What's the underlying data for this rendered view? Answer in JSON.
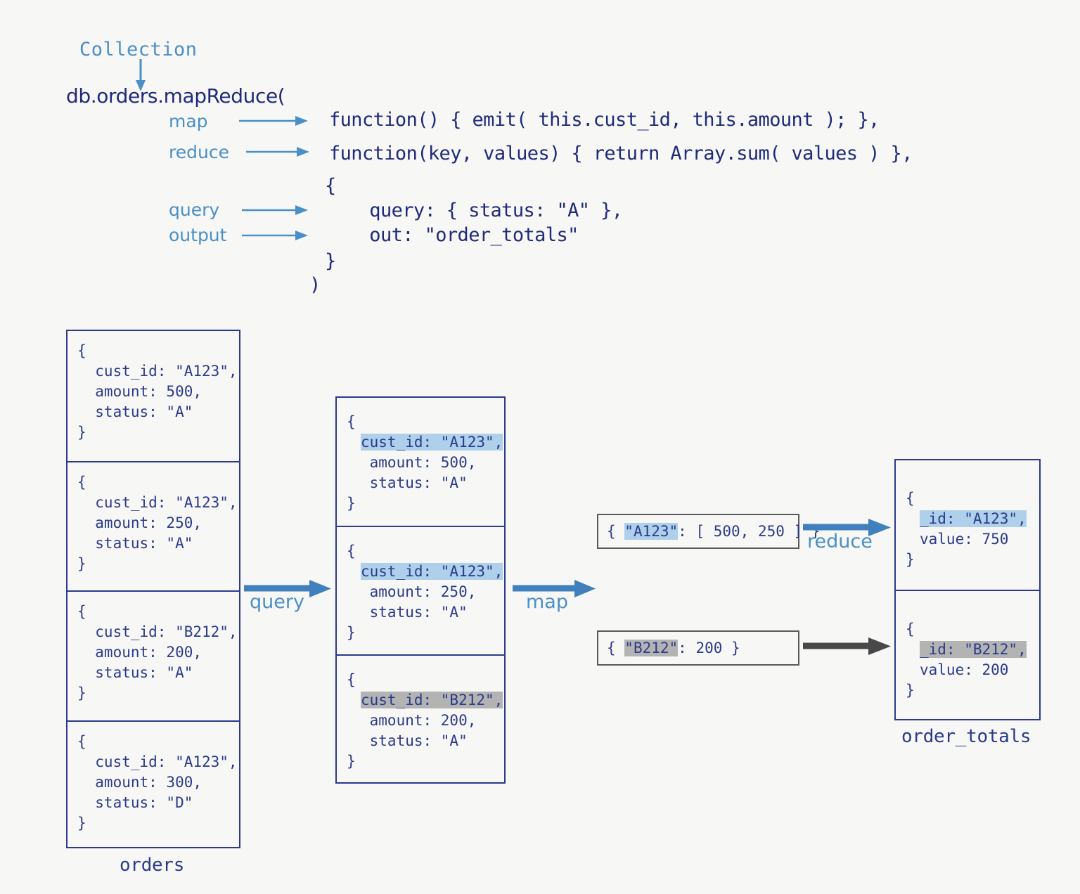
{
  "background": "#f7f7f5",
  "colors": {
    "navy": "#2b3a8c",
    "light_blue": "#4b8fc7",
    "arrow_blue": "#3f80bd",
    "highlight_blue": "#aed0ea",
    "highlight_gray": "#b3b3b3",
    "arrow_gray": "#484848"
  },
  "code": {
    "collection_label": "Collection",
    "call_line": "db.orders.mapReduce(",
    "params": {
      "map": "map",
      "reduce": "reduce",
      "query": "query",
      "output": "output"
    },
    "lines": {
      "map_fn": "function() { emit( this.cust_id, this.amount ); },",
      "reduce_fn": "function(key, values) { return Array.sum( values ) },",
      "open_brace": "{",
      "query_opt": "  query: { status: \"A\" },",
      "out_opt": "  out: \"order_totals\"",
      "close_brace": "}",
      "close_paren": ")"
    }
  },
  "orders": {
    "caption": "orders",
    "documents": [
      {
        "open": "{",
        "cust_id": "  cust_id: \"A123\",",
        "amount": "  amount: 500,",
        "status": "  status: \"A\"",
        "close": "}"
      },
      {
        "open": "{",
        "cust_id": "  cust_id: \"A123\",",
        "amount": "  amount: 250,",
        "status": "  status: \"A\"",
        "close": "}"
      },
      {
        "open": "{",
        "cust_id": "  cust_id: \"B212\",",
        "amount": "  amount: 200,",
        "status": "  status: \"A\"",
        "close": "}"
      },
      {
        "open": "{",
        "cust_id": "  cust_id: \"A123\",",
        "amount": "  amount: 300,",
        "status": "  status: \"D\"",
        "close": "}"
      }
    ]
  },
  "filtered": {
    "documents": [
      {
        "open": "{",
        "cust_id": "cust_id: \"A123\",",
        "highlight": "blue",
        "amount": " amount: 500,",
        "status": " status: \"A\"",
        "close": "}"
      },
      {
        "open": "{",
        "cust_id": "cust_id: \"A123\",",
        "highlight": "blue",
        "amount": " amount: 250,",
        "status": " status: \"A\"",
        "close": "}"
      },
      {
        "open": "{",
        "cust_id": "cust_id: \"B212\",",
        "highlight": "gray",
        "amount": " amount: 200,",
        "status": " status: \"A\"",
        "close": "}"
      }
    ]
  },
  "emits": [
    {
      "prefix": "{ ",
      "key": "\"A123\"",
      "highlight": "blue",
      "rest": ": [ 500, 250 ] }"
    },
    {
      "prefix": "{ ",
      "key": "\"B212\"",
      "highlight": "gray",
      "rest": ": 200 }"
    }
  ],
  "output": {
    "caption": "order_totals",
    "documents": [
      {
        "open": "{",
        "id": "_id: \"A123\",",
        "highlight": "blue",
        "value": "value: 750",
        "close": "}"
      },
      {
        "open": "{",
        "id": "_id: \"B212\",",
        "highlight": "gray",
        "value": "value: 200",
        "close": "}"
      }
    ]
  },
  "flow": {
    "query_label": "query",
    "map_label": "map",
    "reduce_label": "reduce"
  }
}
